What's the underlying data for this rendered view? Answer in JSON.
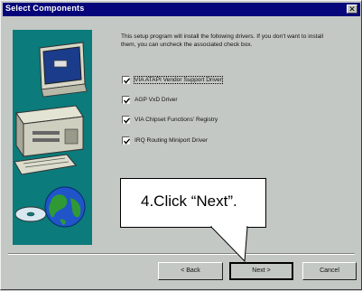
{
  "window": {
    "title": "Select Components",
    "close_glyph": "✕"
  },
  "info_text": "This setup program will install the following drivers. If you don't want to install them, you can uncheck the associated check box.",
  "options": [
    {
      "label": "VIA ATAPI Vendor Support Driver",
      "checked": true
    },
    {
      "label": "AGP VxD Driver",
      "checked": true
    },
    {
      "label": "VIA Chipset Functions' Registry",
      "checked": true
    },
    {
      "label": "IRQ Routing Miniport Driver",
      "checked": true
    }
  ],
  "buttons": {
    "back": "< Back",
    "next": "Next >",
    "cancel": "Cancel"
  },
  "callout": {
    "text": "4.Click “Next”."
  },
  "colors": {
    "titlebar": "#06067a",
    "art_panel": "#0b7b7b",
    "dialog": "#c4c8c4"
  },
  "icons": [
    "computer-illustration",
    "cd-disc-icon",
    "globe-icon",
    "checkmark-icon",
    "close-icon"
  ]
}
